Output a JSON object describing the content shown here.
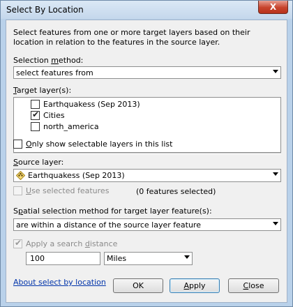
{
  "window": {
    "title": "Select By Location",
    "close_label": "X"
  },
  "description": "Select features from one or more target layers based on their location in relation to the features in the source layer.",
  "selection_method": {
    "label_pre": "Selection ",
    "label_accel": "m",
    "label_post": "ethod:",
    "value": "select features from"
  },
  "target_layers": {
    "label_pre": "",
    "label_accel": "T",
    "label_post": "arget layer(s):",
    "items": [
      {
        "label": "Earthquakess (Sep 2013)",
        "checked": false
      },
      {
        "label": "Cities",
        "checked": true
      },
      {
        "label": "north_america",
        "checked": false
      }
    ]
  },
  "only_selectable": {
    "label_accel": "O",
    "label_post": "nly show selectable layers in this list",
    "checked": false
  },
  "source_layer": {
    "label_pre": "",
    "label_accel": "S",
    "label_post": "ource layer:",
    "value": "Earthquakess (Sep 2013)"
  },
  "use_selected": {
    "label_accel": "U",
    "label_post": "se selected features",
    "checked": false,
    "count_text": "(0 features selected)"
  },
  "spatial_method": {
    "label_pre": "S",
    "label_accel": "p",
    "label_post": "atial selection method for target layer feature(s):",
    "value": "are within a distance of the source layer feature"
  },
  "search_distance": {
    "label_pre": "Apply a search ",
    "label_accel": "d",
    "label_post": "istance",
    "checked": true,
    "value": "100",
    "unit": "Miles"
  },
  "footer": {
    "link": "About select by location",
    "ok": "OK",
    "apply_accel": "A",
    "apply_post": "pply",
    "close_accel": "C",
    "close_post": "lose"
  },
  "colors": {
    "title_bar": "#c4d7ec",
    "close_button": "#c7432c",
    "dialog_bg": "#f0f0f0",
    "link": "#0033aa"
  }
}
